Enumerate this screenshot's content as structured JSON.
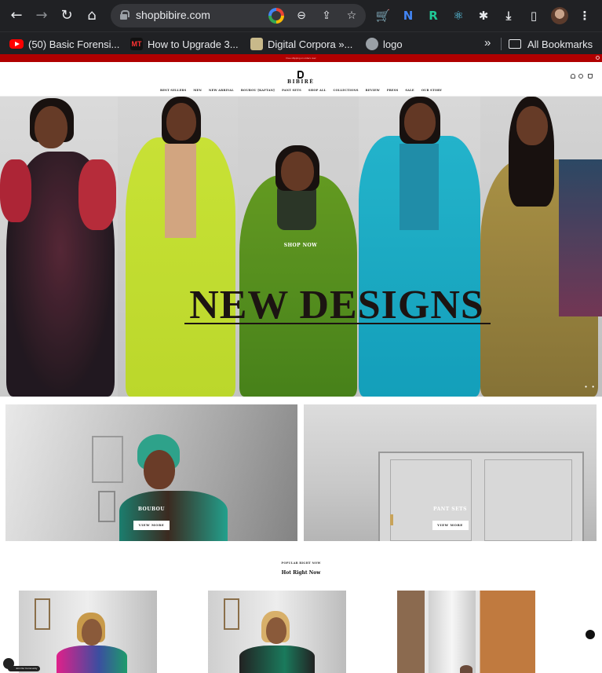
{
  "browser": {
    "url": "shopbibire.com",
    "bookmarks": [
      {
        "label": "(50) Basic Forensi...",
        "icon": "youtube-icon"
      },
      {
        "label": "How to Upgrade 3...",
        "icon": "mt-icon"
      },
      {
        "label": "Digital Corpora »...",
        "icon": "digital-corpora-icon"
      },
      {
        "label": "logo",
        "icon": "globe-icon"
      }
    ],
    "more": "»",
    "all_bookmarks": "All Bookmarks",
    "icons": {
      "back": "←",
      "forward": "→",
      "reload": "↻",
      "home": "⌂",
      "zoom": "⊖",
      "share": "⇪",
      "star": "☆",
      "download": "⤓",
      "panel": "▯",
      "menu": "⋮",
      "puzzle": "✱"
    },
    "extensions": [
      {
        "name": "cart-extension-icon",
        "glyph": "🛒",
        "color": "#34a853"
      },
      {
        "name": "n-extension-icon",
        "glyph": "N",
        "color": "#4285f4"
      },
      {
        "name": "r-extension-icon",
        "glyph": "R",
        "color": "#20c997"
      },
      {
        "name": "react-extension-icon",
        "glyph": "⚛",
        "color": "#61dafb"
      }
    ]
  },
  "site": {
    "promo": "Free shipping on orders over",
    "logo": "BIBIRÉ",
    "nav": [
      "BEST SELLERS",
      "MEN",
      "NEW ARRIVAL",
      "BOUBOU [Kaftan]",
      "PANT SETS",
      "SHOP ALL",
      "COLLECTIONS",
      "REVIEW",
      "PRESS",
      "SALE",
      "OUR STORY"
    ],
    "hero": {
      "cta": "SHOP NOW",
      "headline": "NEW DESIGNS",
      "dots": "• •"
    },
    "tiles": [
      {
        "title": "BOUBOU",
        "button": "VIEW MORE"
      },
      {
        "title": "PANT SETS",
        "button": "VIEW MORE"
      }
    ],
    "popular": {
      "kicker": "POPULAR RIGHT NOW",
      "title": "Hot Right Now"
    },
    "community": "Join Our Community"
  },
  "colors": {
    "chrome": "#202124",
    "omnibox": "#35363a",
    "promo": "#b00000",
    "headline": "#1c1412"
  }
}
